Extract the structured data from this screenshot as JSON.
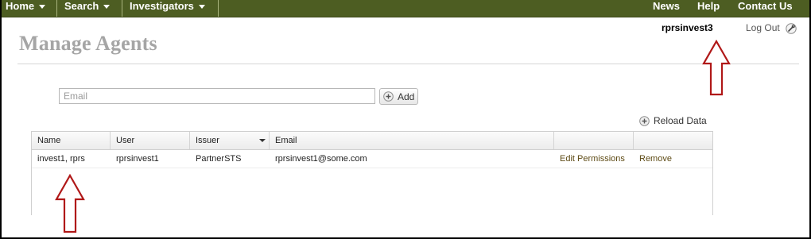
{
  "nav": {
    "left": [
      {
        "label": "Home"
      },
      {
        "label": "Search"
      },
      {
        "label": "Investigators"
      }
    ],
    "right": [
      {
        "label": "News"
      },
      {
        "label": "Help"
      },
      {
        "label": "Contact Us"
      }
    ]
  },
  "header": {
    "title": "Manage Agents",
    "user": "rprsinvest3",
    "logout_label": "Log Out"
  },
  "add_form": {
    "email_placeholder": "Email",
    "add_label": "Add"
  },
  "reload_label": "Reload Data",
  "grid": {
    "columns": [
      "Name",
      "User",
      "Issuer",
      "Email",
      "",
      ""
    ],
    "rows": [
      {
        "name": "invest1, rprs",
        "user": "rprsinvest1",
        "issuer": "PartnerSTS",
        "email": "rprsinvest1@some.com",
        "edit_label": "Edit Permissions",
        "remove_label": "Remove"
      }
    ]
  },
  "colors": {
    "nav_bg": "#4d5d22",
    "title": "#a5a5a5",
    "annotation_arrow": "#b01818"
  },
  "icons": [
    "caret-down-icon",
    "settings-icon",
    "plus-circle-icon",
    "annotation-arrow-icon"
  ]
}
